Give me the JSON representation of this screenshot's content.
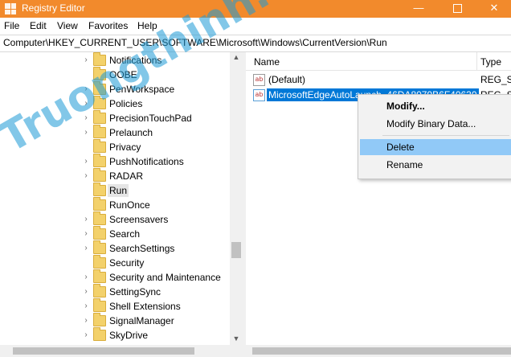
{
  "window": {
    "title": "Registry Editor",
    "accent_color": "#f28a2c",
    "buttons": {
      "minimize": "—",
      "maximize": "",
      "close": "✕"
    }
  },
  "menu": [
    "File",
    "Edit",
    "View",
    "Favorites",
    "Help"
  ],
  "address": "Computer\\HKEY_CURRENT_USER\\SOFTWARE\\Microsoft\\Windows\\CurrentVersion\\Run",
  "tree": {
    "items": [
      {
        "label": "Notifications",
        "expandable": true
      },
      {
        "label": "OOBE",
        "expandable": false
      },
      {
        "label": "PenWorkspace",
        "expandable": true
      },
      {
        "label": "Policies",
        "expandable": true
      },
      {
        "label": "PrecisionTouchPad",
        "expandable": true
      },
      {
        "label": "Prelaunch",
        "expandable": true
      },
      {
        "label": "Privacy",
        "expandable": false
      },
      {
        "label": "PushNotifications",
        "expandable": true
      },
      {
        "label": "RADAR",
        "expandable": true
      },
      {
        "label": "Run",
        "expandable": false,
        "selected": true
      },
      {
        "label": "RunOnce",
        "expandable": false
      },
      {
        "label": "Screensavers",
        "expandable": true
      },
      {
        "label": "Search",
        "expandable": true
      },
      {
        "label": "SearchSettings",
        "expandable": true
      },
      {
        "label": "Security",
        "expandable": false
      },
      {
        "label": "Security and Maintenance",
        "expandable": true
      },
      {
        "label": "SettingSync",
        "expandable": true
      },
      {
        "label": "Shell Extensions",
        "expandable": true
      },
      {
        "label": "SignalManager",
        "expandable": true
      },
      {
        "label": "SkyDrive",
        "expandable": true
      }
    ]
  },
  "list": {
    "columns": {
      "name": "Name",
      "type": "Type"
    },
    "rows": [
      {
        "name": "(Default)",
        "type": "REG_SZ"
      },
      {
        "name": "MicrosoftEdgeAutoLaunch_46DA8079B6F40630",
        "type": "REG_SZ",
        "selected": true
      }
    ]
  },
  "context_menu": {
    "items": [
      "Modify...",
      "Modify Binary Data...",
      "Delete",
      "Rename"
    ],
    "highlighted": "Delete"
  },
  "watermark": "Truongthinh.org",
  "icons": {
    "value": "ab",
    "chevron": "›"
  }
}
